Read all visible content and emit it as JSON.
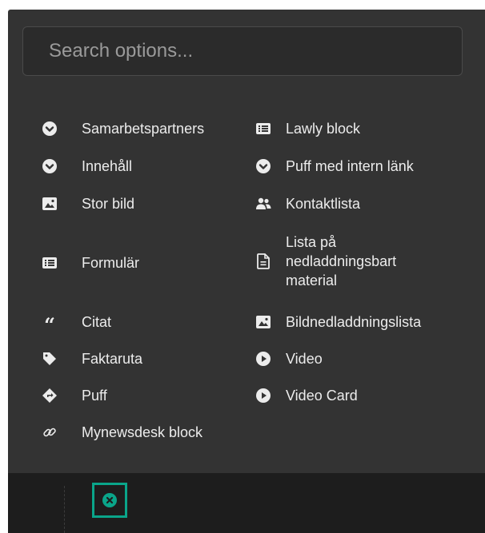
{
  "search": {
    "placeholder": "Search options..."
  },
  "options_left": [
    {
      "label": "Samarbetspartners",
      "icon": "chevron-down-circle-icon"
    },
    {
      "label": "Innehåll",
      "icon": "chevron-down-circle-icon"
    },
    {
      "label": "Stor bild",
      "icon": "image-icon"
    },
    {
      "label": "Formulär",
      "icon": "list-icon"
    },
    {
      "label": "Citat",
      "icon": "quote-icon"
    },
    {
      "label": "Faktaruta",
      "icon": "tag-icon"
    },
    {
      "label": "Puff",
      "icon": "directions-icon"
    },
    {
      "label": "Mynewsdesk block",
      "icon": "link-icon"
    }
  ],
  "options_right": [
    {
      "label": "Lawly block",
      "icon": "list-icon"
    },
    {
      "label": "Puff med intern länk",
      "icon": "chevron-down-circle-icon"
    },
    {
      "label": "Kontaktlista",
      "icon": "users-icon"
    },
    {
      "label": "Lista på nedladdningsbart material",
      "icon": "file-icon"
    },
    {
      "label": "Bildnedladdningslista",
      "icon": "image-icon"
    },
    {
      "label": "Video",
      "icon": "play-circle-icon"
    },
    {
      "label": "Video Card",
      "icon": "play-circle-icon"
    }
  ],
  "colors": {
    "panel": "#333333",
    "text": "#ececec",
    "accent": "#0aa58a",
    "footer": "#1d1d1d"
  }
}
